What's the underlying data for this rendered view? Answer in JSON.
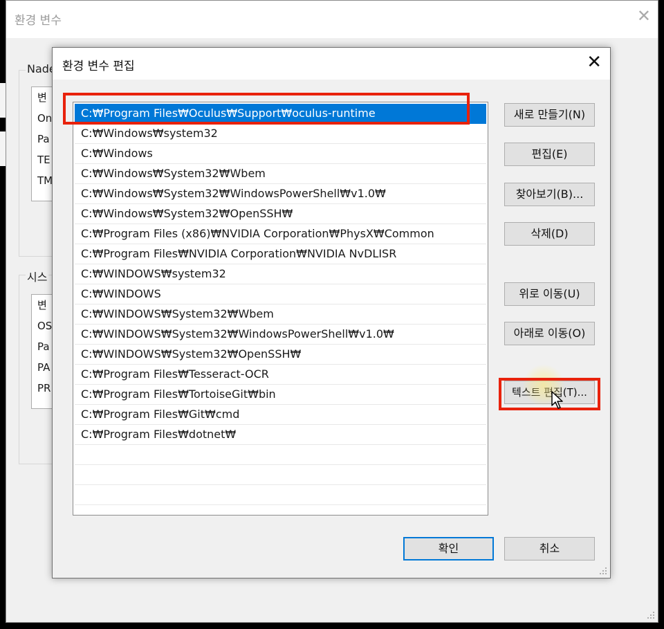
{
  "parent_window": {
    "title": "환경 변수",
    "close_glyph": "✕",
    "user_group_label": "Nade",
    "user_list_header": "변",
    "user_list_rows": [
      "On",
      "Pa",
      "TE",
      "TM"
    ],
    "system_group_label": "시스",
    "system_list_header": "변",
    "system_list_rows": [
      "OS",
      "Pa",
      "PA",
      "PR"
    ]
  },
  "dialog": {
    "title": "환경 변수 편집",
    "close_glyph": "✕",
    "path_entries": [
      "C:₩Program Files₩Oculus₩Support₩oculus-runtime",
      "C:₩Windows₩system32",
      "C:₩Windows",
      "C:₩Windows₩System32₩Wbem",
      "C:₩Windows₩System32₩WindowsPowerShell₩v1.0₩",
      "C:₩Windows₩System32₩OpenSSH₩",
      "C:₩Program Files (x86)₩NVIDIA Corporation₩PhysX₩Common",
      "C:₩Program Files₩NVIDIA Corporation₩NVIDIA NvDLISR",
      "C:₩WINDOWS₩system32",
      "C:₩WINDOWS",
      "C:₩WINDOWS₩System32₩Wbem",
      "C:₩WINDOWS₩System32₩WindowsPowerShell₩v1.0₩",
      "C:₩WINDOWS₩System32₩OpenSSH₩",
      "C:₩Program Files₩Tesseract-OCR",
      "C:₩Program Files₩TortoiseGit₩bin",
      "C:₩Program Files₩Git₩cmd",
      "C:₩Program Files₩dotnet₩"
    ],
    "selected_index": 0,
    "buttons": {
      "new": "새로 만들기(N)",
      "edit": "편집(E)",
      "browse": "찾아보기(B)...",
      "delete": "삭제(D)",
      "move_up": "위로 이동(U)",
      "move_down": "아래로 이동(O)",
      "edit_text": "텍스트 편집(T)...",
      "ok": "확인",
      "cancel": "취소"
    }
  },
  "colors": {
    "selection": "#0078d7",
    "highlight_box": "#e8220c"
  }
}
